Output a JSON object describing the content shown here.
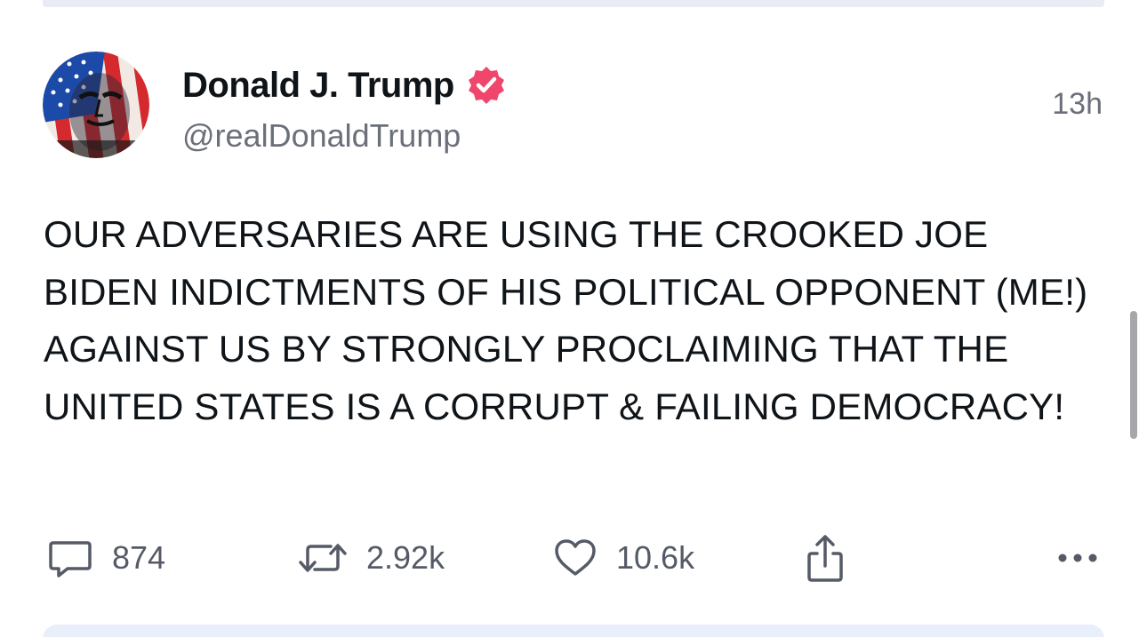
{
  "post": {
    "author": {
      "display_name": "Donald J. Trump",
      "handle": "@realDonaldTrump",
      "verified": true,
      "verified_color": "#f0466b"
    },
    "timestamp": "13h",
    "text": "OUR ADVERSARIES ARE USING THE CROOKED JOE BIDEN INDICTMENTS OF HIS POLITICAL OPPONENT (ME!) AGAINST US BY STRONGLY PROCLAIMING THAT THE UNITED STATES IS A CORRUPT & FAILING DEMOCRACY!",
    "actions": {
      "reply": {
        "icon": "speech-bubble-icon",
        "count": "874"
      },
      "repost": {
        "icon": "repost-arrows-icon",
        "count": "2.92k"
      },
      "like": {
        "icon": "heart-icon",
        "count": "10.6k"
      },
      "share": {
        "icon": "share-upload-icon"
      },
      "more": {
        "icon": "more-dots-icon"
      }
    }
  },
  "colors": {
    "text": "#0f1419",
    "secondary_text": "#6b6f7a",
    "icon": "#555a66",
    "divider": "#e9ebf5",
    "scrollbar": "#a7a7ab"
  }
}
